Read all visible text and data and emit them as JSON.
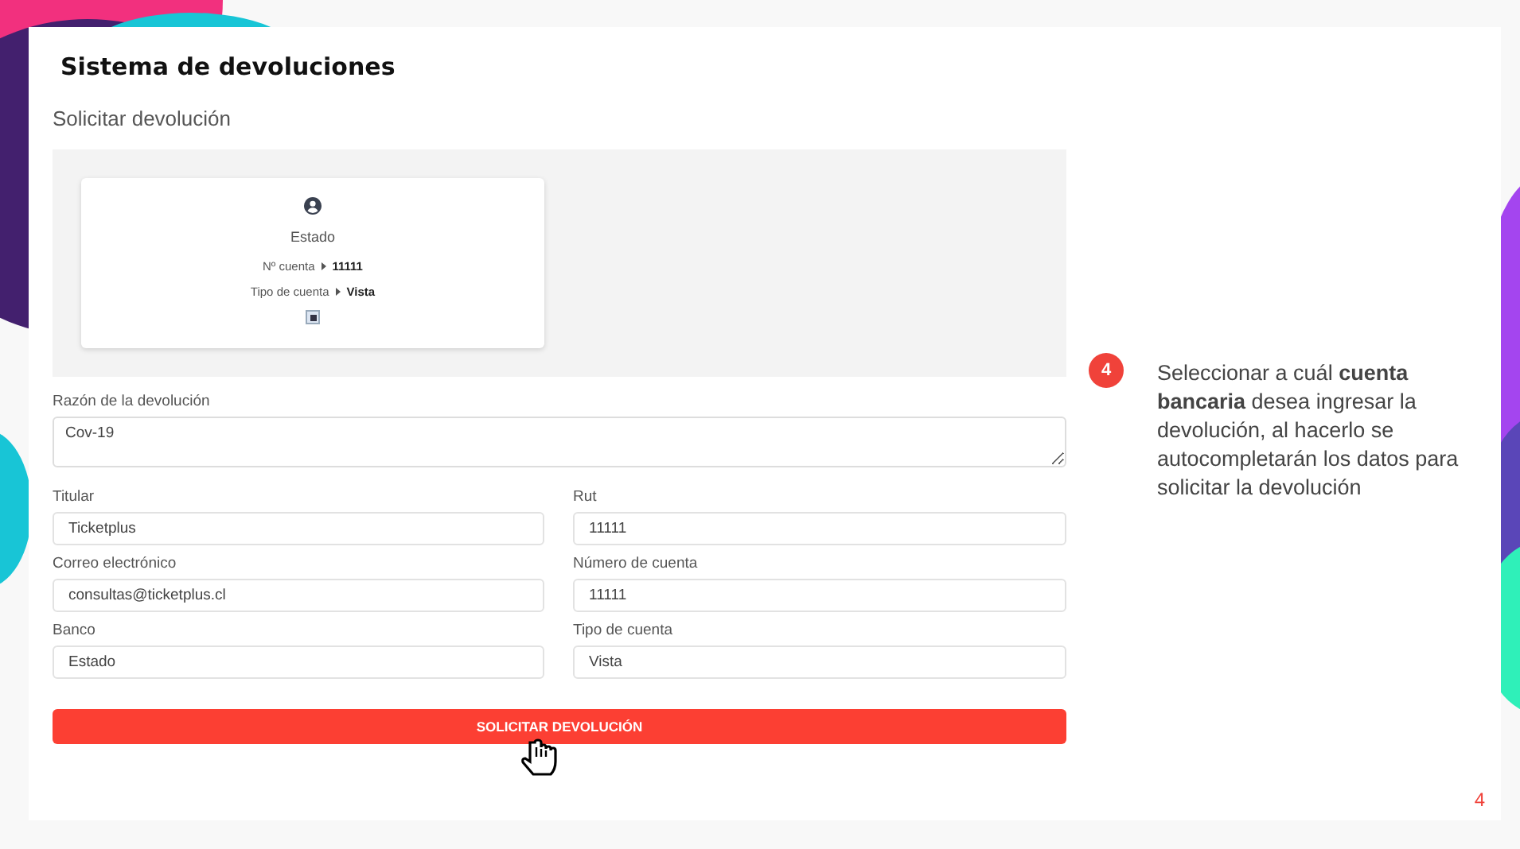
{
  "slide": {
    "title": "Sistema de devoluciones",
    "page_number": "4"
  },
  "app": {
    "heading": "Solicitar devolución",
    "account_card": {
      "bank": "Estado",
      "rows": [
        {
          "label": "Nº cuenta",
          "value": "11111"
        },
        {
          "label": "Tipo de cuenta",
          "value": "Vista"
        }
      ],
      "selected": true
    },
    "reason": {
      "label": "Razón de la devolución",
      "value": "Cov-19"
    },
    "fields": [
      {
        "label": "Titular",
        "value": "Ticketplus"
      },
      {
        "label": "Rut",
        "value": "11111"
      },
      {
        "label": "Correo electrónico",
        "value": "consultas@ticketplus.cl"
      },
      {
        "label": "Número de cuenta",
        "value": "11111"
      },
      {
        "label": "Banco",
        "value": "Estado"
      },
      {
        "label": "Tipo de cuenta",
        "value": "Vista"
      }
    ],
    "submit": "SOLICITAR DEVOLUCIÓN"
  },
  "callout": {
    "step": "4",
    "text": "Seleccionar a cuál **cuenta bancaria** desea ingresar la devolución, al hacerlo se autocompletarán los datos para solicitar la devolución"
  }
}
